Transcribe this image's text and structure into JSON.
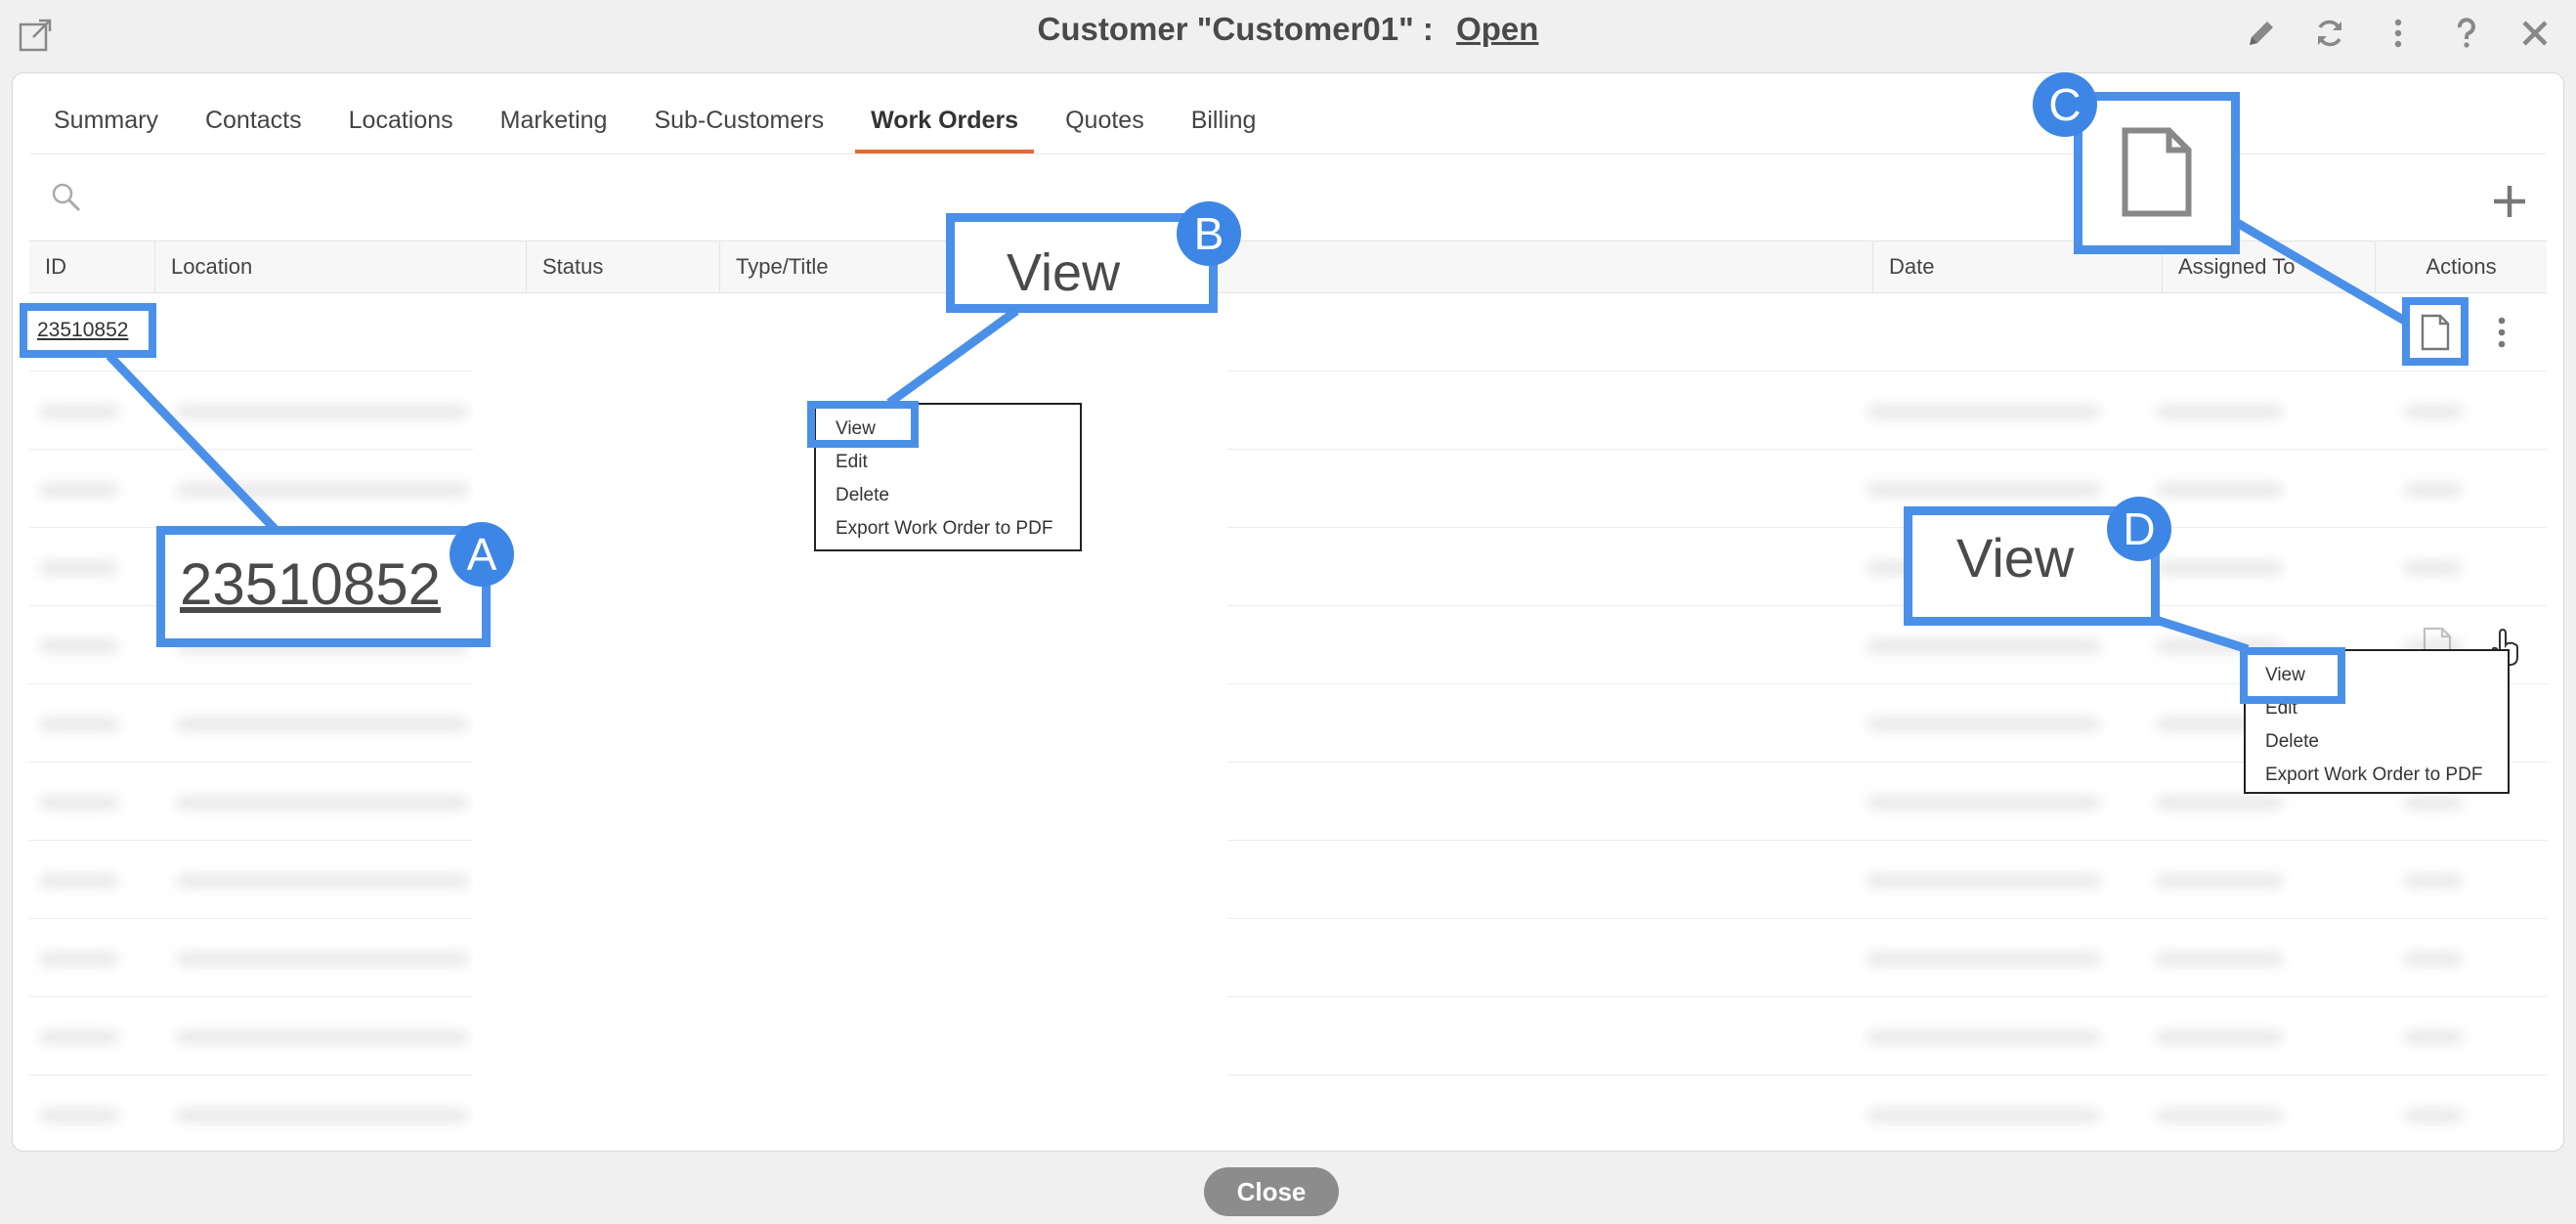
{
  "window": {
    "title_prefix": "Customer \"Customer01\" :",
    "title_status": "Open"
  },
  "toolbar_icons": [
    "edit-icon",
    "refresh-icon",
    "more-vertical-icon",
    "help-icon",
    "close-icon"
  ],
  "tabs": [
    {
      "label": "Summary"
    },
    {
      "label": "Contacts"
    },
    {
      "label": "Locations"
    },
    {
      "label": "Marketing"
    },
    {
      "label": "Sub-Customers"
    },
    {
      "label": "Work Orders",
      "active": true
    },
    {
      "label": "Quotes"
    },
    {
      "label": "Billing"
    }
  ],
  "table": {
    "columns": [
      "ID",
      "Location",
      "Status",
      "Type/Title",
      "Date",
      "Assigned To",
      "Actions"
    ],
    "first_row_id": "23510852"
  },
  "context_menu_items": [
    "View",
    "Edit",
    "Delete",
    "Export Work Order to PDF"
  ],
  "callouts": {
    "a": {
      "badge": "A",
      "text": "23510852"
    },
    "b": {
      "badge": "B",
      "text": "View"
    },
    "c": {
      "badge": "C"
    },
    "d": {
      "badge": "D",
      "text": "View"
    }
  },
  "footer": {
    "close_label": "Close"
  },
  "colors": {
    "accent_tab": "#e16b35",
    "callout_blue": "#4a90e8",
    "close_button": "#8c8c8c"
  }
}
